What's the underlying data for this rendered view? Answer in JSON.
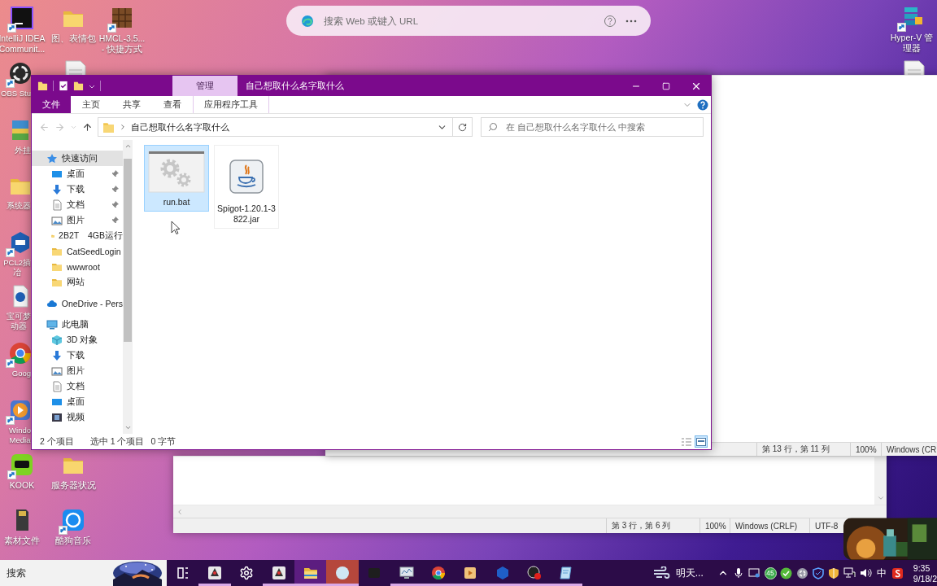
{
  "browser_bar": {
    "placeholder": "搜索 Web 或键入 URL"
  },
  "desktop_icons": [
    {
      "kind": "ide",
      "shortcut": true,
      "label": [
        "IntelliJ IDEA",
        "Communit..."
      ]
    },
    {
      "kind": "folder",
      "shortcut": false,
      "label": [
        "图、表情包"
      ]
    },
    {
      "kind": "crate",
      "shortcut": true,
      "label": [
        "HMCL-3.5...",
        "- 快捷方式"
      ]
    },
    {
      "kind": "ring",
      "shortcut": true,
      "label": [
        "OBS Stu"
      ]
    },
    {
      "kind": "document",
      "shortcut": false
    },
    {
      "kind": "archive",
      "shortcut": false,
      "label": [
        "外挂"
      ]
    },
    {
      "kind": "folder",
      "shortcut": false,
      "label": [
        "系统器"
      ]
    },
    {
      "kind": "badge",
      "shortcut": true,
      "label": [
        "PCL2插",
        "冶"
      ]
    },
    {
      "kind": "badge-doc",
      "shortcut": false,
      "label": [
        "宝可梦",
        "动器"
      ]
    },
    {
      "kind": "browser",
      "shortcut": true,
      "label": [
        "Goog"
      ]
    },
    {
      "kind": "media",
      "shortcut": true,
      "label": [
        "Windo",
        "Media"
      ]
    },
    {
      "kind": "chat",
      "shortcut": true,
      "label": [
        "KOOK"
      ]
    },
    {
      "kind": "folder",
      "shortcut": false,
      "label": [
        "服务器状况"
      ]
    },
    {
      "kind": "card",
      "shortcut": false,
      "label": [
        "素材文件"
      ]
    },
    {
      "kind": "music",
      "shortcut": true,
      "label": [
        "酷狗音乐"
      ]
    },
    {
      "kind": "server",
      "shortcut": true,
      "label": [
        "Hyper-V 管",
        "理器"
      ]
    },
    {
      "kind": "document",
      "shortcut": false
    }
  ],
  "notepad_windows": [
    {
      "status": [
        "第 3 行，第 6 列",
        "100%",
        "Windows (CRLF)",
        "UTF-8"
      ]
    },
    {
      "status": [
        "第 13 行，第 11 列",
        "100%",
        "Windows (CR"
      ]
    }
  ],
  "explorer": {
    "context_tab": "管理",
    "title": "自己想取什么名字取什么",
    "ribbon_tabs": [
      {
        "label": "文件",
        "kind": "file"
      },
      {
        "label": "主页",
        "kind": "tab"
      },
      {
        "label": "共享",
        "kind": "tab"
      },
      {
        "label": "查看",
        "kind": "tab"
      },
      {
        "label": "应用程序工具",
        "kind": "contextual"
      }
    ],
    "path": "自己想取什么名字取什么",
    "search": {
      "placeholder": "在 自己想取什么名字取什么 中搜索"
    },
    "nav": [
      {
        "label": "快速访问",
        "kind": "star",
        "selected": true,
        "children": [
          {
            "label": "桌面",
            "kind": "desktop",
            "pinned": true,
            "selected": false
          },
          {
            "label": "下载",
            "kind": "download",
            "pinned": true,
            "selected": false
          },
          {
            "label": "文档",
            "kind": "document",
            "pinned": true,
            "selected": false
          },
          {
            "label": "图片",
            "kind": "picture",
            "pinned": true,
            "selected": false
          },
          {
            "label": "2B2T　4GB运行",
            "kind": "folder",
            "pinned": false,
            "selected": false
          },
          {
            "label": "CatSeedLogin",
            "kind": "folder",
            "pinned": false,
            "selected": false
          },
          {
            "label": "wwwroot",
            "kind": "folder",
            "pinned": false,
            "selected": false
          },
          {
            "label": "网站",
            "kind": "folder",
            "pinned": false,
            "selected": false
          }
        ]
      },
      {
        "label": "OneDrive - Pers",
        "kind": "cloud",
        "selected": false
      },
      {
        "label": "此电脑",
        "kind": "pc",
        "selected": false,
        "children": [
          {
            "label": "3D 对象",
            "kind": "cube",
            "pinned": false,
            "selected": false
          },
          {
            "label": "下载",
            "kind": "download",
            "pinned": false,
            "selected": false
          },
          {
            "label": "图片",
            "kind": "picture",
            "pinned": false,
            "selected": false
          },
          {
            "label": "文档",
            "kind": "document",
            "pinned": false,
            "selected": false
          },
          {
            "label": "桌面",
            "kind": "desktop",
            "pinned": false,
            "selected": false
          },
          {
            "label": "视频",
            "kind": "video",
            "pinned": false,
            "selected": false
          }
        ]
      }
    ],
    "files": [
      {
        "name": "run.bat",
        "kind": "batch",
        "selected": true
      },
      {
        "name": "Spigot-1.20.1-3822.jar",
        "kind": "jar",
        "selected": false
      }
    ],
    "status": {
      "count": "2 个项目",
      "selection": "选中 1 个项目",
      "size": "0 字节"
    },
    "view_buttons": [
      {
        "kind": "details",
        "selected": false
      },
      {
        "kind": "tiles",
        "selected": true
      }
    ]
  },
  "taskbar": {
    "search_placeholder": "搜索",
    "apps": [
      {
        "kind": "task-view",
        "running": false,
        "focused": false,
        "attention": false
      },
      {
        "kind": "mascot",
        "running": true,
        "focused": false,
        "attention": false
      },
      {
        "kind": "settings",
        "running": false,
        "focused": false,
        "attention": false
      },
      {
        "kind": "mascot",
        "running": true,
        "focused": false,
        "attention": false
      },
      {
        "kind": "folder",
        "running": true,
        "focused": true,
        "attention": false
      },
      {
        "kind": "orb",
        "running": true,
        "focused": false,
        "attention": true
      },
      {
        "kind": "dark",
        "running": false,
        "focused": false,
        "attention": false
      },
      {
        "kind": "monitor",
        "running": true,
        "focused": false,
        "attention": false
      },
      {
        "kind": "browser",
        "running": true,
        "focused": false,
        "attention": false
      },
      {
        "kind": "video",
        "running": true,
        "focused": false,
        "attention": false
      },
      {
        "kind": "hexagon",
        "running": true,
        "focused": false,
        "attention": false
      },
      {
        "kind": "record",
        "running": true,
        "focused": false,
        "attention": false
      },
      {
        "kind": "notepad",
        "running": true,
        "focused": false,
        "attention": false
      }
    ],
    "weather": "明天...",
    "tray": [
      {
        "kind": "chevron"
      },
      {
        "kind": "mic"
      },
      {
        "kind": "display"
      },
      {
        "kind": "badge",
        "text": "45"
      },
      {
        "kind": "check"
      },
      {
        "kind": "fan"
      },
      {
        "kind": "shield"
      },
      {
        "kind": "shield-gold"
      },
      {
        "kind": "network"
      },
      {
        "kind": "volume"
      },
      {
        "kind": "ime",
        "text": "中"
      },
      {
        "kind": "logo"
      }
    ],
    "time": "9:35",
    "date": "9/18/2"
  }
}
